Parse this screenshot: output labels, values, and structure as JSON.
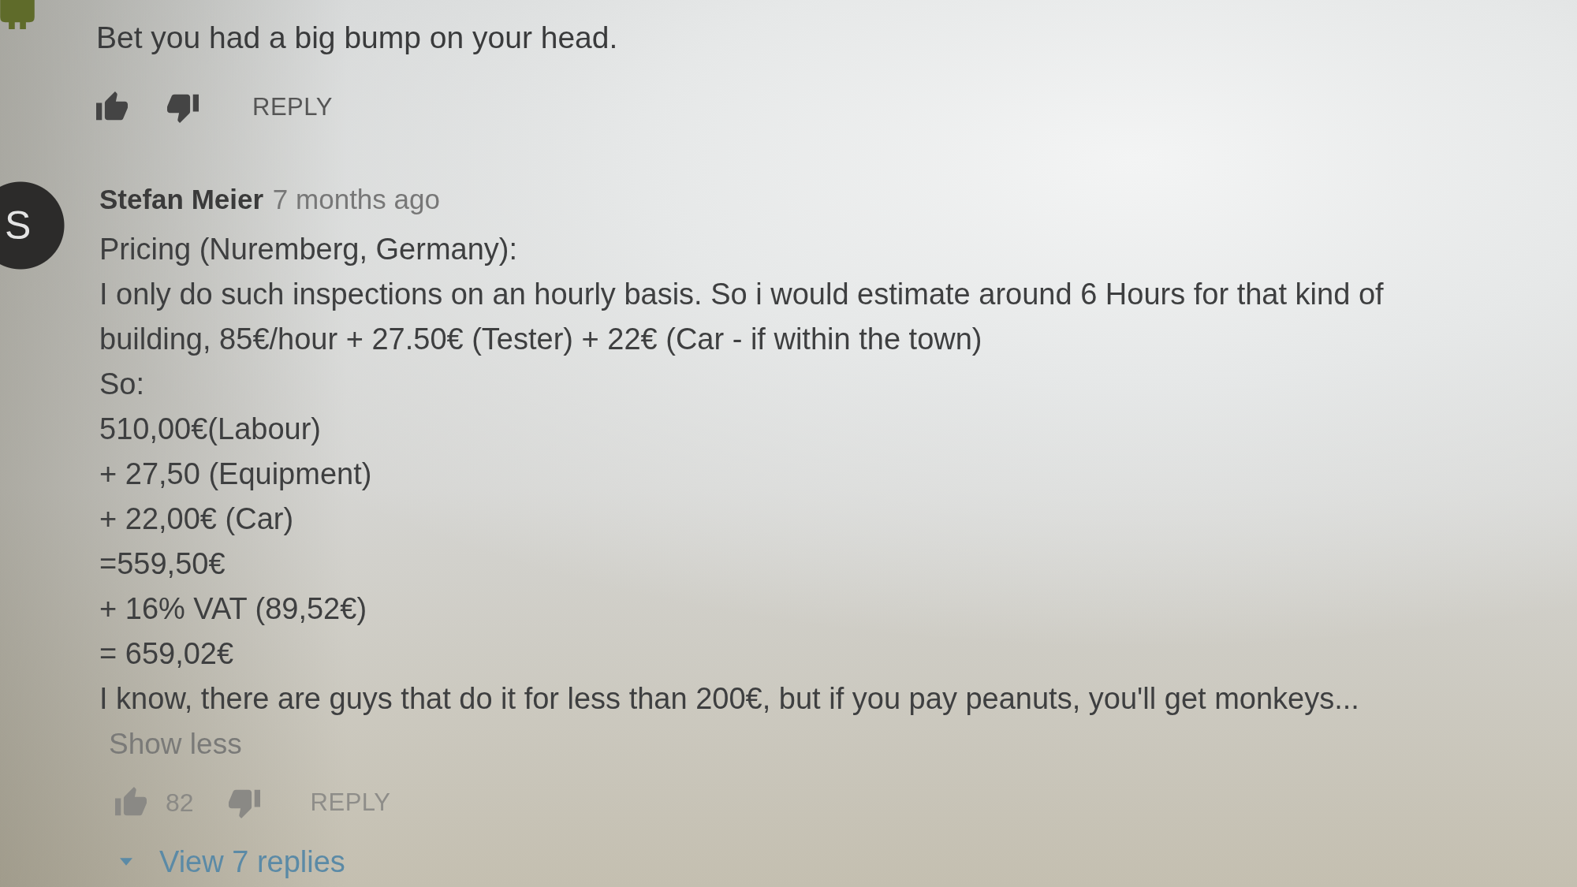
{
  "previous_comment": {
    "text": "Bet you had a big bump on your head.",
    "reply": "REPLY"
  },
  "comment": {
    "avatar_initial": "S",
    "author": "Stefan Meier",
    "time": "7 months ago",
    "body": [
      "Pricing (Nuremberg, Germany):",
      "I only do such inspections on an hourly basis. So i would estimate around 6 Hours for that kind of building, 85€/hour + 27.50€ (Tester) + 22€ (Car - if within the town)",
      "So:",
      "510,00€(Labour)",
      "+ 27,50 (Equipment)",
      "+ 22,00€ (Car)",
      "=559,50€",
      "+ 16% VAT (89,52€)",
      "= 659,02€",
      "I know, there are guys that do it for less than 200€, but if you pay peanuts, you'll get monkeys..."
    ],
    "show_less": "Show less",
    "likes": "82",
    "reply": "REPLY",
    "view_replies": "View 7 replies"
  }
}
